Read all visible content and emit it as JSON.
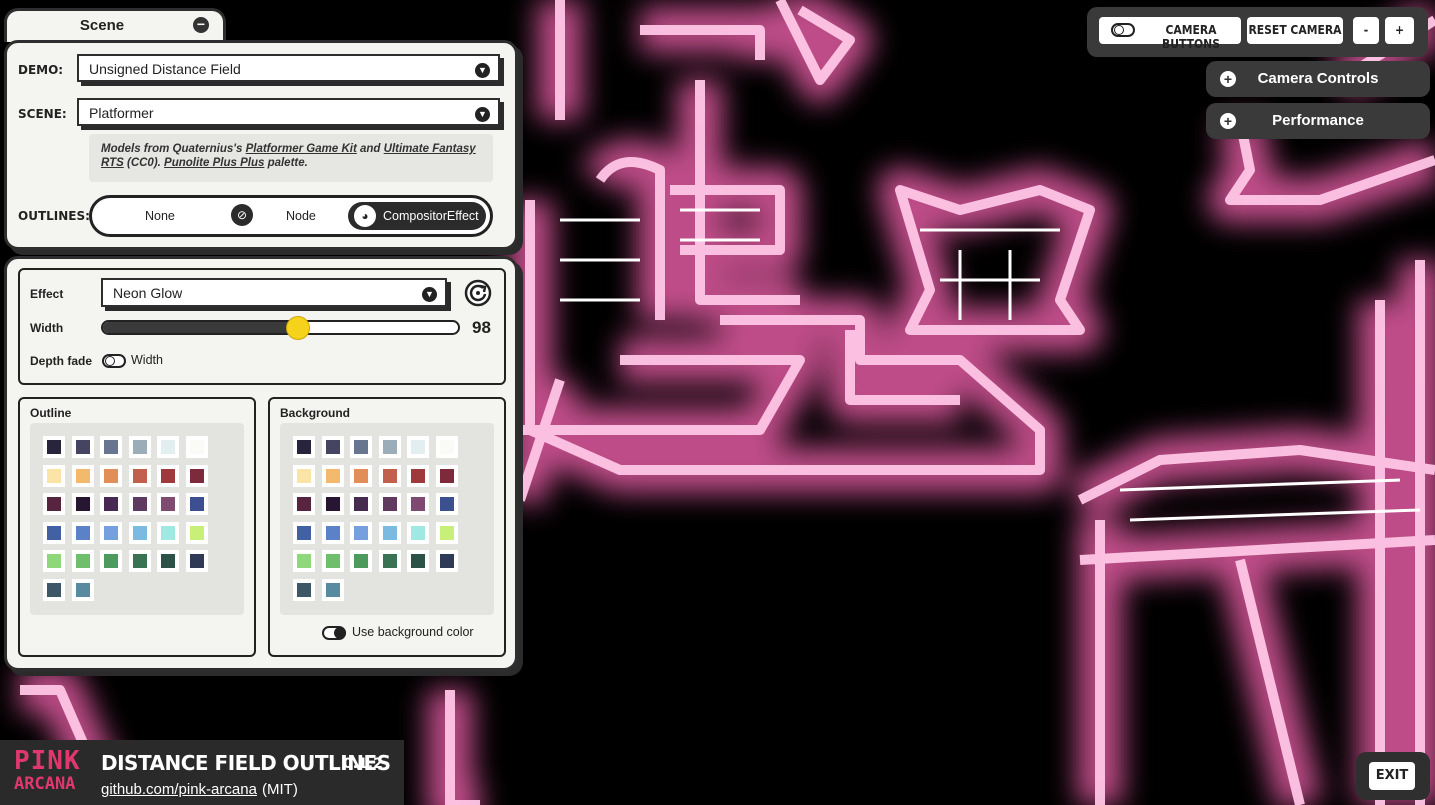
{
  "scene_tab": {
    "title": "Scene",
    "collapse_symbol": "−"
  },
  "demo": {
    "label": "DEMO:",
    "value": "Unsigned Distance Field"
  },
  "scene": {
    "label": "SCENE:",
    "value": "Platformer"
  },
  "credits": {
    "prefix": "Models from Quaternius's ",
    "link1": "Platformer Game Kit",
    "mid": " and ",
    "link2": "Ultimate Fantasy RTS",
    "after": " (CC0). ",
    "link3": "Punolite Plus Plus",
    "suffix": " palette."
  },
  "outlines": {
    "label": "OUTLINES:",
    "options": [
      "None",
      "Node",
      "CompositorEffect"
    ],
    "selected": "CompositorEffect"
  },
  "effect": {
    "label": "Effect",
    "value": "Neon Glow"
  },
  "width": {
    "label": "Width",
    "value": "98",
    "fraction": 0.55
  },
  "depth_fade": {
    "label": "Depth fade",
    "toggle_label": "Width",
    "on": false
  },
  "outline_palette": {
    "title": "Outline"
  },
  "background_palette": {
    "title": "Background",
    "use_bg_label": "Use background color",
    "use_bg_on": true
  },
  "palette_colors": [
    "#28243c",
    "#454562",
    "#687591",
    "#9aadb8",
    "#e2eeef",
    "#fafbf6",
    "#fbe5a6",
    "#f3b96d",
    "#e18e59",
    "#c1614d",
    "#9f3a3c",
    "#7c2a3c",
    "#56243f",
    "#281532",
    "#472a52",
    "#5e3b5e",
    "#7e4a71",
    "#3c4f8e",
    "#4261a3",
    "#5b82c7",
    "#75a0dd",
    "#7bbbe2",
    "#a0e9e2",
    "#c8ef78",
    "#8ed77a",
    "#6ebe6c",
    "#4c9a5c",
    "#3a7254",
    "#2c5146",
    "#2e3a56",
    "#3e5767",
    "#588aa0"
  ],
  "camera": {
    "toggle_label": "CAMERA BUTTONS",
    "reset_label": "RESET CAMERA",
    "minus": "-",
    "plus": "+"
  },
  "camera_controls": {
    "label": "Camera Controls"
  },
  "performance": {
    "label": "Performance"
  },
  "footer": {
    "logo_line1": "PINK",
    "logo_line2": "ARCANA",
    "title": "DISTANCE FIELD OUTLINES",
    "version": "0.1.2",
    "repo": "github.com/pink-arcana",
    "license": "(MIT)"
  },
  "exit": {
    "label": "EXIT"
  },
  "colors": {
    "neon": "#ff5fb4",
    "panel": "#f4f5f1",
    "accent_knob": "#f7d21a"
  }
}
